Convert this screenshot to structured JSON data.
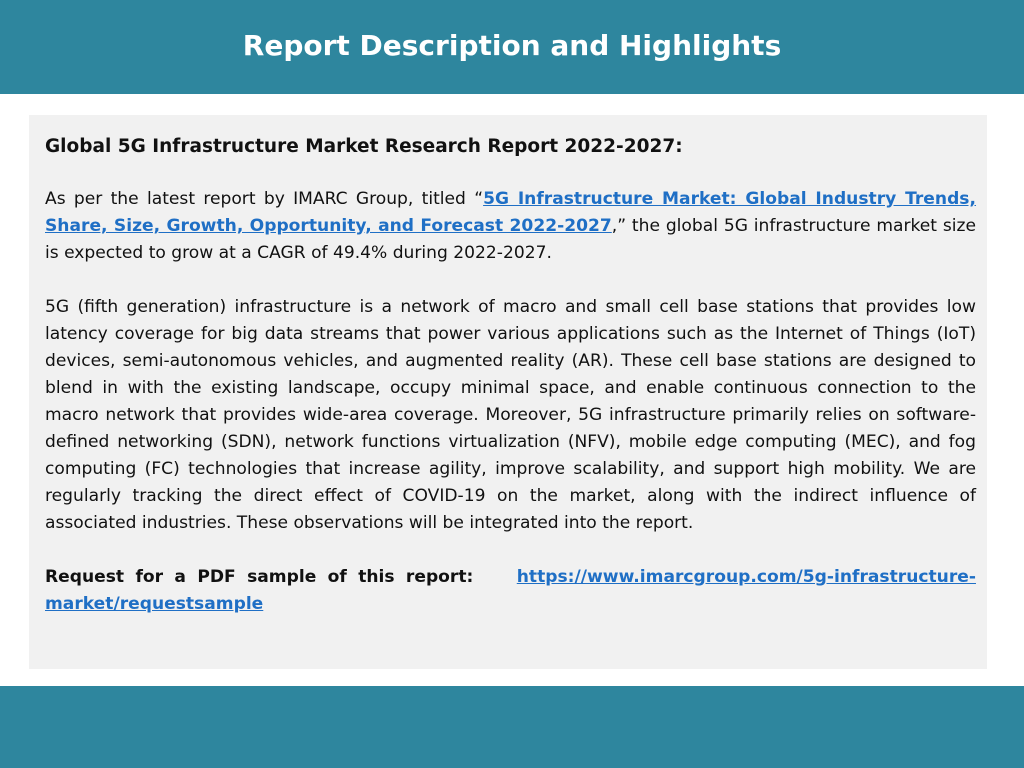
{
  "header": {
    "title": "Report Description and Highlights"
  },
  "content": {
    "heading": "Global 5G Infrastructure Market Research Report 2022-2027:",
    "intro": {
      "before": "As per the latest report by IMARC Group, titled “",
      "link_text": "5G Infrastructure Market: Global Industry Trends, Share, Size, Growth, Opportunity, and Forecast 2022-2027",
      "after": ",” the global 5G infrastructure market size is expected to grow at a CAGR of 49.4% during 2022-2027."
    },
    "body": "5G (fifth generation) infrastructure is a network of macro and small cell base stations that provides low latency coverage for big data streams that power various applications such as the Internet of Things (IoT) devices, semi-autonomous vehicles, and augmented reality (AR). These cell base stations are designed to blend in with the existing landscape, occupy minimal space, and enable continuous connection to the macro network that provides wide-area coverage. Moreover, 5G infrastructure primarily relies on software-defined networking (SDN), network functions virtualization (NFV), mobile edge computing (MEC), and fog computing (FC) technologies that increase agility, improve scalability, and support high mobility. We are regularly tracking the direct effect of COVID-19 on the market, along with the indirect influence of associated industries. These observations will be integrated into the report.",
    "sample": {
      "label": "Request for a PDF sample of this report:",
      "url": "https://www.imarcgroup.com/5g-infrastructure-market/requestsample"
    }
  },
  "colors": {
    "band": "#2e869e",
    "panel": "#f1f1f1",
    "link": "#1f6fc5"
  }
}
